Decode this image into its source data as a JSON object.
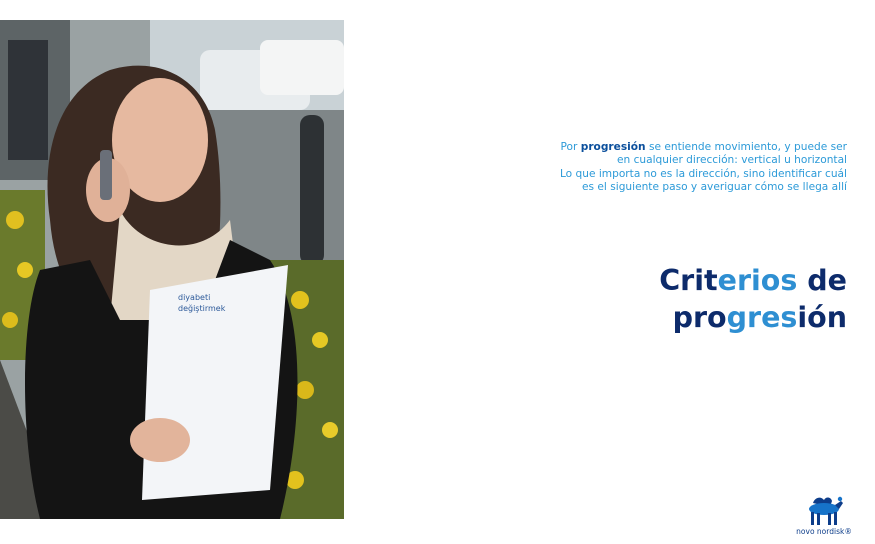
{
  "slide": {
    "intro": {
      "l1_pre": "Por ",
      "l1_emph": "progresión",
      "l1_post": " se entiende movimiento, y puede ser",
      "l2": "en cualquier dirección: vertical u horizontal",
      "l3": "Lo que importa no es la dirección, sino identificar cuál",
      "l4": "es el siguiente paso y averiguar cómo se llega allí"
    },
    "title": {
      "t1": "Crit",
      "t2": "erios",
      "t3": " de",
      "t4": "pro",
      "t5": "gres",
      "t6": "ión"
    },
    "photo": {
      "folder_text_1": "diyabeti",
      "folder_text_2": "değiştirmek"
    },
    "logo": {
      "text": "novo nordisk®",
      "icon": "apis-bull-icon"
    }
  },
  "colors": {
    "title_dark": "#0d2b6b",
    "title_light": "#2e8fd2",
    "intro_text": "#2c9ad8",
    "intro_emph": "#0b4f9c",
    "logo_blue": "#0d3d8a"
  }
}
